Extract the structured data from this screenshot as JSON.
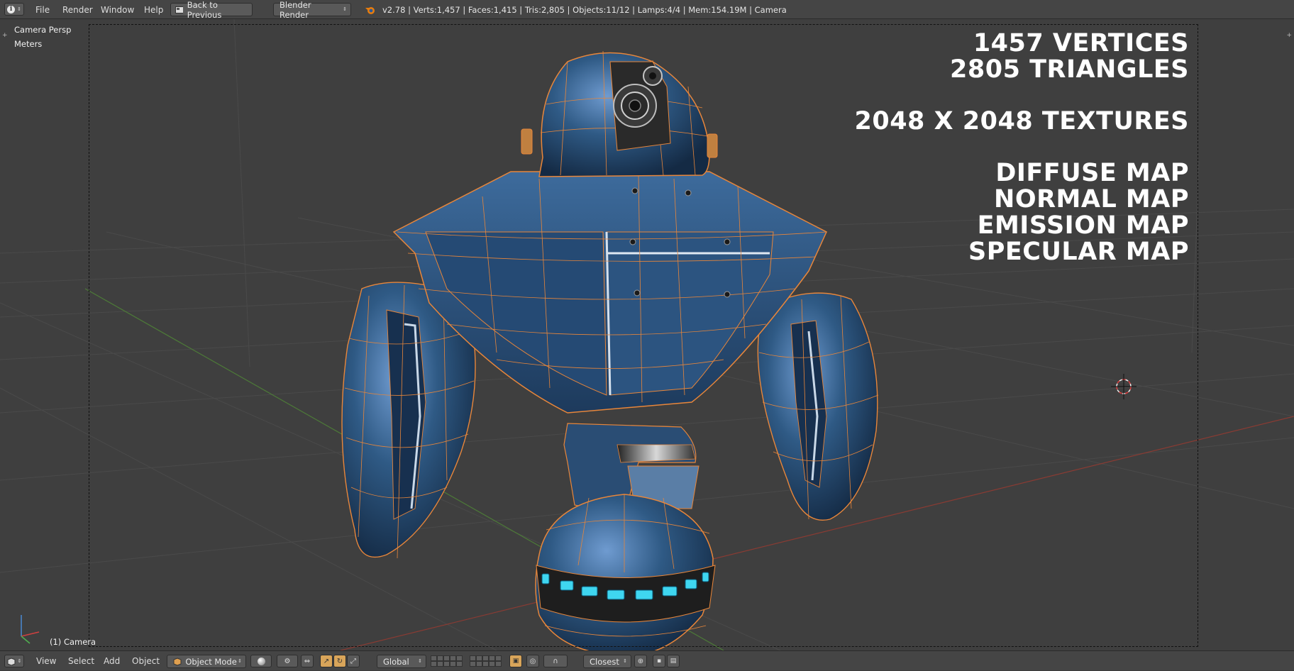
{
  "header": {
    "info_icon": "info-icon",
    "menus": [
      "File",
      "Render",
      "Window",
      "Help"
    ],
    "back_button": "Back to Previous",
    "render_engine": "Blender Render",
    "stats": "v2.78 | Verts:1,457 | Faces:1,415 | Tris:2,805 | Objects:11/12 | Lamps:4/4 | Mem:154.19M | Camera"
  },
  "viewport": {
    "view_name": "Camera Persp",
    "units": "Meters",
    "object_label": "(1) Camera",
    "overlay_lines": [
      "1457 VERTICES",
      "2805 TRIANGLES",
      "2048 X 2048 TEXTURES",
      "DIFFUSE MAP",
      "NORMAL MAP",
      "EMISSION MAP",
      "SPECULAR MAP"
    ]
  },
  "footer": {
    "menus": [
      "View",
      "Select",
      "Add",
      "Object"
    ],
    "mode": "Object Mode",
    "orientation": "Global",
    "snap_target": "Closest"
  },
  "colors": {
    "wire": "#e8863a",
    "armor": "#2f5a85",
    "glow": "#3fd6f0"
  }
}
